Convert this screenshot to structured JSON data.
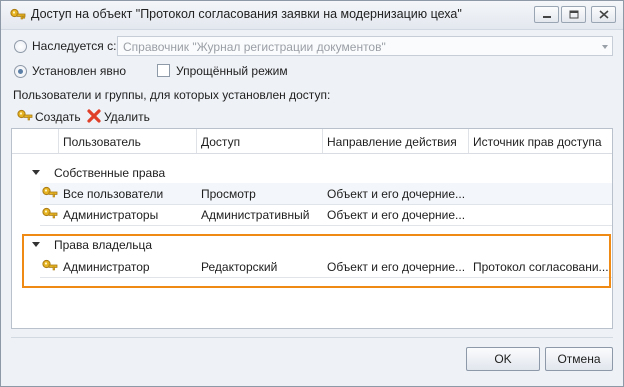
{
  "window": {
    "title": "Доступ на объект \"Протокол согласования заявки на модернизацию цеха\""
  },
  "inherit": {
    "label": "Наследуется с:",
    "value": "Справочник \"Журнал регистрации документов\""
  },
  "explicit": {
    "label": "Установлен явно"
  },
  "simple_mode": {
    "label": "Упрощённый режим",
    "checked": false
  },
  "users_caption": "Пользователи и группы, для которых установлен доступ:",
  "toolbar": {
    "create_label": "Создать",
    "delete_label": "Удалить"
  },
  "table": {
    "columns": [
      "Пользователь",
      "Доступ",
      "Направление действия",
      "Источник прав доступа"
    ],
    "groups": [
      {
        "label": "Собственные права",
        "rows": [
          {
            "user": "Все пользователи",
            "access": "Просмотр",
            "direction": "Объект и его дочерние...",
            "source": ""
          },
          {
            "user": "Администраторы",
            "access": "Административный",
            "direction": "Объект и его дочерние...",
            "source": ""
          }
        ]
      },
      {
        "label": "Права владельца",
        "rows": [
          {
            "user": "Администратор",
            "access": "Редакторский",
            "direction": "Объект и его дочерние...",
            "source": "Протокол согласовани..."
          }
        ]
      }
    ]
  },
  "buttons": {
    "ok": "OK",
    "cancel": "Отмена"
  },
  "colors": {
    "highlight": "#ef8b14",
    "key_icon": "#e6b422",
    "delete_icon": "#e0402a"
  }
}
